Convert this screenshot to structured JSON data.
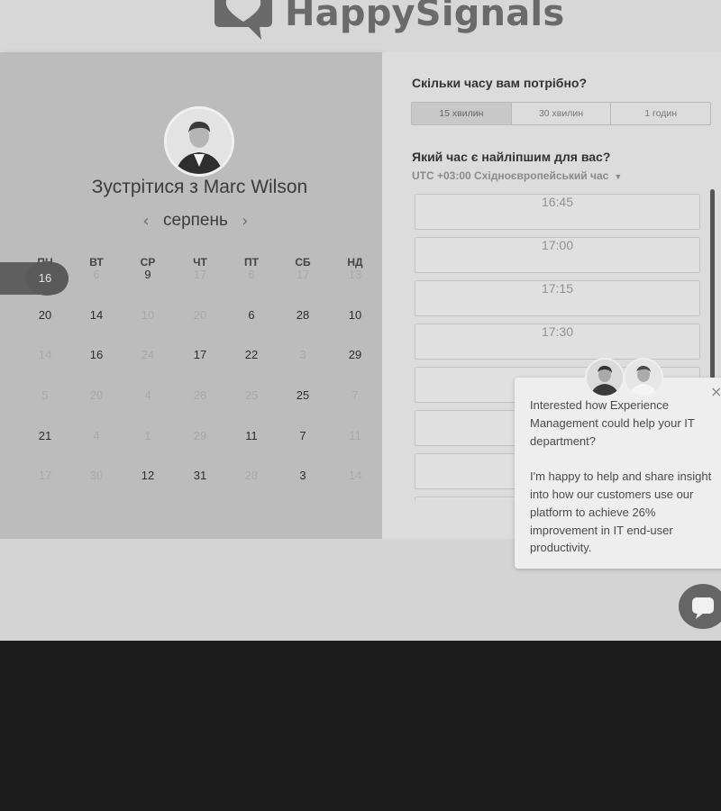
{
  "brand": {
    "logo_text": "HappySignals"
  },
  "host": {
    "title": "Зустрітися з Marc Wilson"
  },
  "calendar": {
    "month": "серпень",
    "weekdays": [
      "ПН",
      "ВТ",
      "СР",
      "ЧТ",
      "ПТ",
      "СБ",
      "НД"
    ],
    "selected_day": "16",
    "rows": [
      [
        {
          "t": "16",
          "s": "selected"
        },
        {
          "t": "6",
          "s": "dim"
        },
        {
          "t": "9",
          "s": "active"
        },
        {
          "t": "17",
          "s": "dim"
        },
        {
          "t": "6",
          "s": "dim"
        },
        {
          "t": "17",
          "s": "dim"
        },
        {
          "t": "13",
          "s": "dim"
        }
      ],
      [
        {
          "t": "20",
          "s": "active"
        },
        {
          "t": "14",
          "s": "active"
        },
        {
          "t": "10",
          "s": "dim"
        },
        {
          "t": "20",
          "s": "dim"
        },
        {
          "t": "6",
          "s": "active"
        },
        {
          "t": "28",
          "s": "active"
        },
        {
          "t": "10",
          "s": "active"
        }
      ],
      [
        {
          "t": "14",
          "s": "dim"
        },
        {
          "t": "16",
          "s": "active"
        },
        {
          "t": "24",
          "s": "dim"
        },
        {
          "t": "17",
          "s": "active"
        },
        {
          "t": "22",
          "s": "active"
        },
        {
          "t": "3",
          "s": "dim"
        },
        {
          "t": "29",
          "s": "active"
        }
      ],
      [
        {
          "t": "5",
          "s": "dim"
        },
        {
          "t": "20",
          "s": "dim"
        },
        {
          "t": "4",
          "s": "dim"
        },
        {
          "t": "28",
          "s": "dim"
        },
        {
          "t": "25",
          "s": "dim"
        },
        {
          "t": "25",
          "s": "active"
        },
        {
          "t": "7",
          "s": "dim"
        }
      ],
      [
        {
          "t": "21",
          "s": "active"
        },
        {
          "t": "4",
          "s": "dim"
        },
        {
          "t": "1",
          "s": "dim"
        },
        {
          "t": "29",
          "s": "dim"
        },
        {
          "t": "11",
          "s": "active"
        },
        {
          "t": "7",
          "s": "active"
        },
        {
          "t": "11",
          "s": "dim"
        }
      ],
      [
        {
          "t": "17",
          "s": "dim"
        },
        {
          "t": "30",
          "s": "dim"
        },
        {
          "t": "12",
          "s": "active"
        },
        {
          "t": "31",
          "s": "active"
        },
        {
          "t": "28",
          "s": "dim"
        },
        {
          "t": "3",
          "s": "active"
        },
        {
          "t": "14",
          "s": "dim"
        }
      ]
    ]
  },
  "booking": {
    "duration_question": "Скільки часу вам потрібно?",
    "durations": [
      "15 хвилин",
      "30 хвилин",
      "1 годин"
    ],
    "selected_duration": "15 хвилин",
    "time_question": "Який час є найліпшим для вас?",
    "timezone": "UTC +03:00 Східноєвропейський час",
    "slots": [
      "16:45",
      "17:00",
      "17:15",
      "17:30",
      "",
      "",
      "",
      ""
    ]
  },
  "chat": {
    "message_1": "Interested how Experience Management could help your IT department?",
    "message_2": "I'm happy to help and share insight into how our customers use our platform to achieve 26% improvement in IT end-user productivity.",
    "close_glyph": "×"
  },
  "icons": {
    "logo": "heart-speech-bubble-icon",
    "prev": "chevron-left-icon",
    "next": "chevron-right-icon",
    "dropdown": "caret-down-icon",
    "close": "close-icon",
    "launcher": "chat-bubble-icon"
  },
  "colors": {
    "page_bg": "#d4d4d4",
    "left_panel": "#bcbcbc",
    "right_panel": "#dcdcdc",
    "selected_day": "#5a5a5a",
    "footer": "#1c1c1c"
  }
}
